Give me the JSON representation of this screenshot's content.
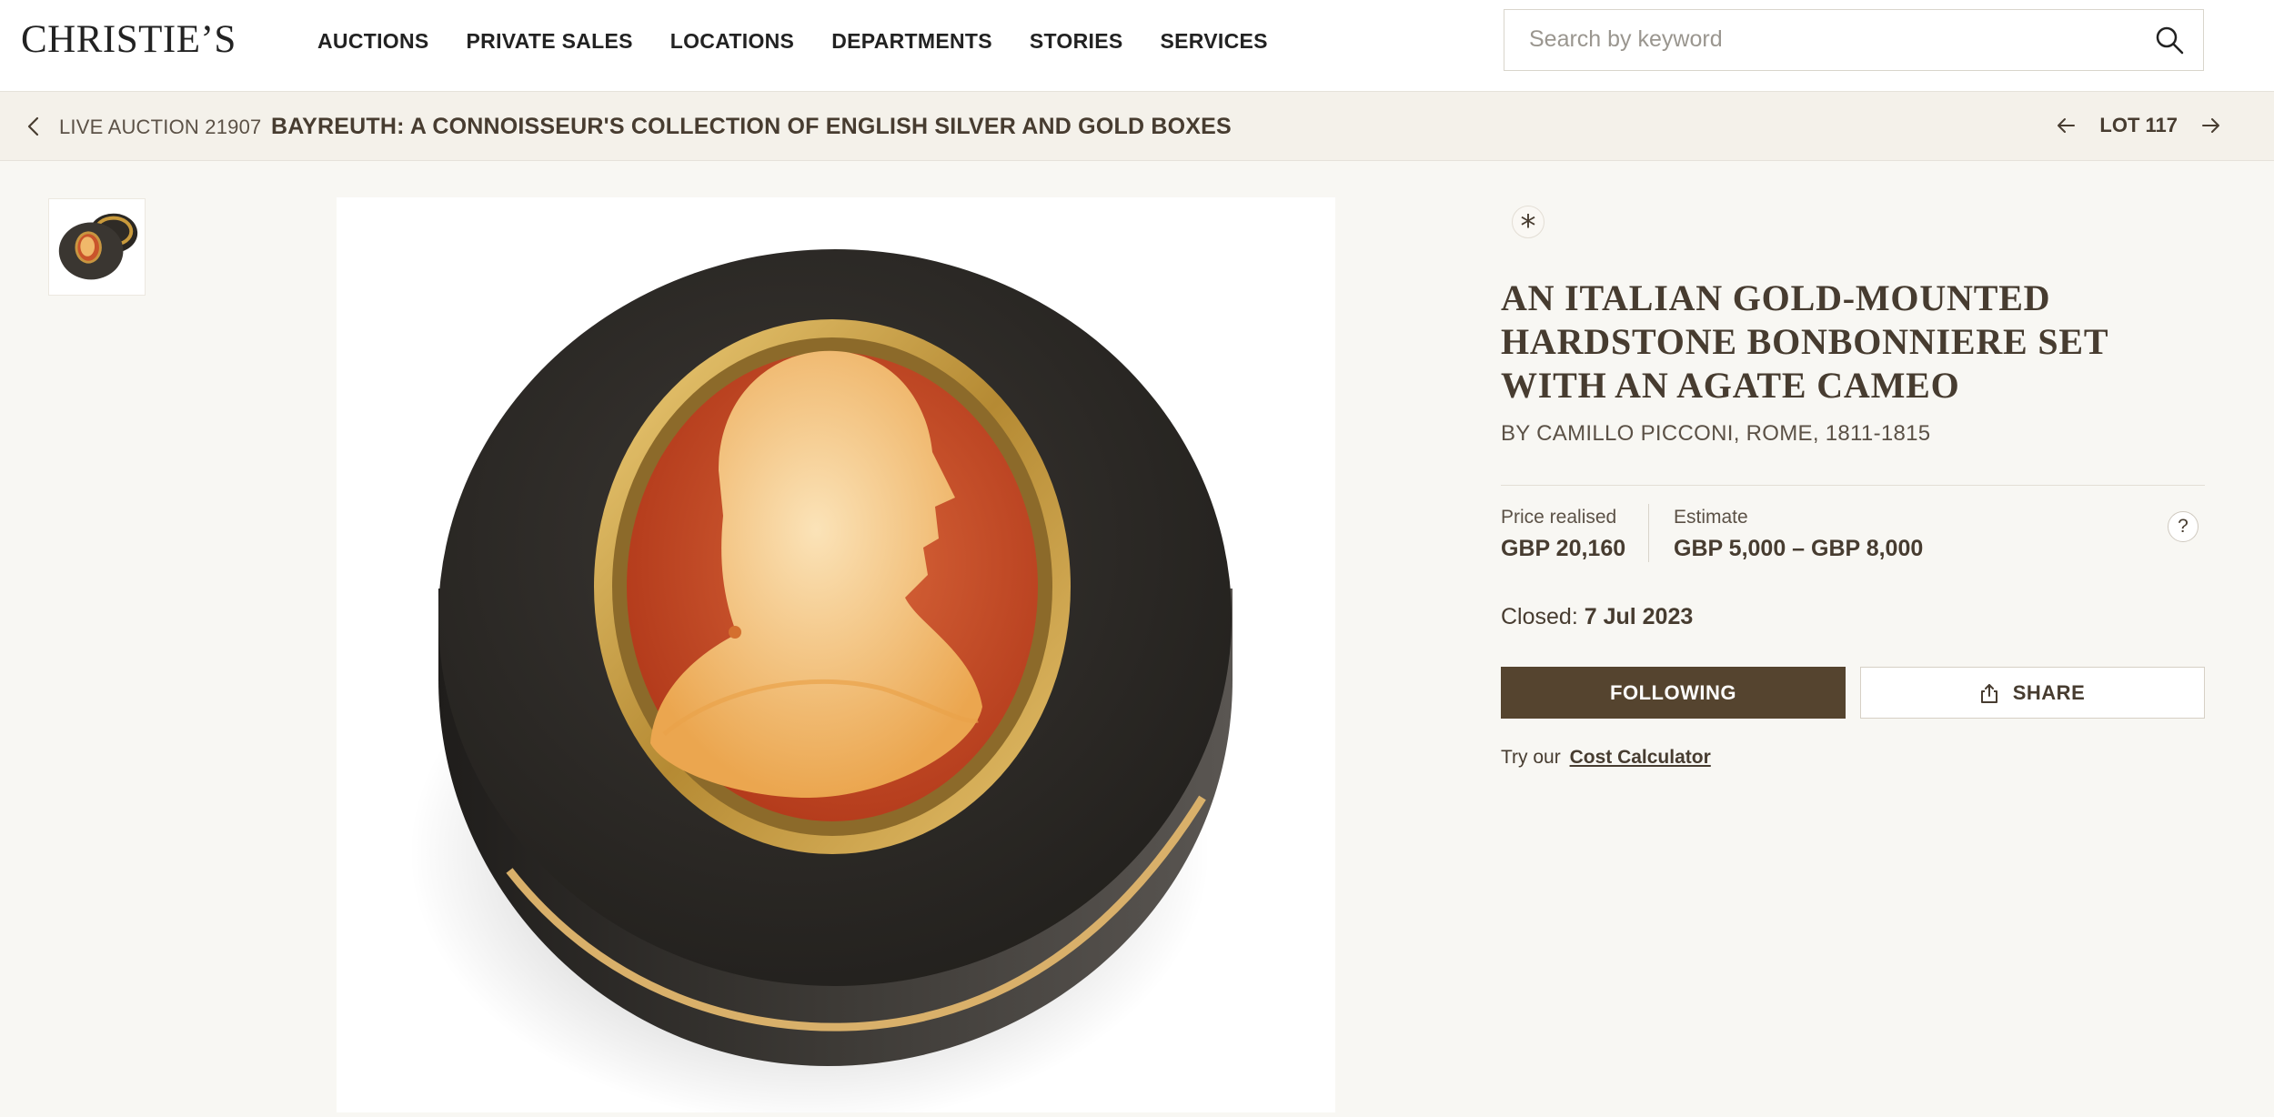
{
  "header": {
    "logo": "CHRISTIE’S",
    "nav": [
      "AUCTIONS",
      "PRIVATE SALES",
      "LOCATIONS",
      "DEPARTMENTS",
      "STORIES",
      "SERVICES"
    ],
    "search_placeholder": "Search by keyword",
    "search_value": ""
  },
  "subbar": {
    "auction_prefix": "LIVE AUCTION 21907",
    "auction_title": "BAYREUTH: A CONNOISSEUR'S COLLECTION OF ENGLISH SILVER AND GOLD BOXES",
    "lot_label": "LOT 117"
  },
  "lot": {
    "badge": "*",
    "title": "AN ITALIAN GOLD-MOUNTED HARDSTONE BONBONNIERE SET WITH AN AGATE CAMEO",
    "subtitle": "BY CAMILLO PICCONI, ROME, 1811-1815",
    "price_label": "Price realised",
    "price_value": "GBP 20,160",
    "estimate_label": "Estimate",
    "estimate_value": "GBP 5,000 – GBP 8,000",
    "help": "?",
    "closed_label": "Closed:",
    "closed_date": "7 Jul 2023",
    "follow_label": "FOLLOWING",
    "share_label": "SHARE",
    "cost_prefix": "Try our",
    "cost_link": "Cost Calculator"
  },
  "colors": {
    "brand_brown": "#55442f",
    "text": "#473c30",
    "page_bg": "#f8f7f3"
  },
  "icons": [
    "search-icon",
    "chevron-left-icon",
    "arrow-left-icon",
    "arrow-right-icon",
    "share-icon",
    "question-icon"
  ]
}
